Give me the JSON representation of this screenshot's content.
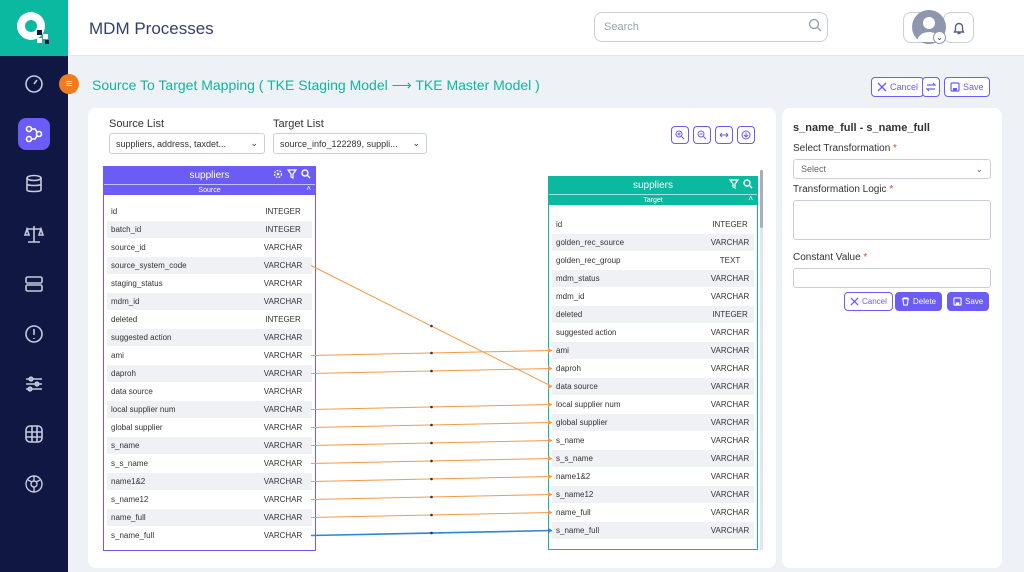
{
  "app": {
    "title": "MDM Processes"
  },
  "search": {
    "placeholder": "Search"
  },
  "page": {
    "heading": "Source To Target Mapping ( TKE Staging Model  ⟶  TKE Master Model )"
  },
  "actions": {
    "cancel": "Cancel",
    "save": "Save"
  },
  "source_list": {
    "label": "Source List",
    "value": "suppliers, address, taxdet..."
  },
  "target_list": {
    "label": "Target List",
    "value": "source_info_122289, suppli..."
  },
  "source_table": {
    "title": "suppliers",
    "subtitle": "Source",
    "rows": [
      [
        "id",
        "INTEGER"
      ],
      [
        "batch_id",
        "INTEGER"
      ],
      [
        "source_id",
        "VARCHAR"
      ],
      [
        "source_system_code",
        "VARCHAR"
      ],
      [
        "staging_status",
        "VARCHAR"
      ],
      [
        "mdm_id",
        "VARCHAR"
      ],
      [
        "deleted",
        "INTEGER"
      ],
      [
        "suggested action",
        "VARCHAR"
      ],
      [
        "ami",
        "VARCHAR"
      ],
      [
        "daproh",
        "VARCHAR"
      ],
      [
        "data source",
        "VARCHAR"
      ],
      [
        "local supplier num",
        "VARCHAR"
      ],
      [
        "global supplier",
        "VARCHAR"
      ],
      [
        "s_name",
        "VARCHAR"
      ],
      [
        "s_s_name",
        "VARCHAR"
      ],
      [
        "name1&2",
        "VARCHAR"
      ],
      [
        "s_name12",
        "VARCHAR"
      ],
      [
        "name_full",
        "VARCHAR"
      ],
      [
        "s_name_full",
        "VARCHAR"
      ]
    ]
  },
  "target_table": {
    "title": "suppliers",
    "subtitle": "Target",
    "rows": [
      [
        "id",
        "INTEGER"
      ],
      [
        "golden_rec_source",
        "VARCHAR"
      ],
      [
        "golden_rec_group",
        "TEXT"
      ],
      [
        "mdm_status",
        "VARCHAR"
      ],
      [
        "mdm_id",
        "VARCHAR"
      ],
      [
        "deleted",
        "INTEGER"
      ],
      [
        "suggested action",
        "VARCHAR"
      ],
      [
        "ami",
        "VARCHAR"
      ],
      [
        "daproh",
        "VARCHAR"
      ],
      [
        "data source",
        "VARCHAR"
      ],
      [
        "local supplier num",
        "VARCHAR"
      ],
      [
        "global supplier",
        "VARCHAR"
      ],
      [
        "s_name",
        "VARCHAR"
      ],
      [
        "s_s_name",
        "VARCHAR"
      ],
      [
        "name1&2",
        "VARCHAR"
      ],
      [
        "s_name12",
        "VARCHAR"
      ],
      [
        "name_full",
        "VARCHAR"
      ],
      [
        "s_name_full",
        "VARCHAR"
      ]
    ]
  },
  "mappings": [
    {
      "source": "source_system_code",
      "target": "data source",
      "color": "#f39a4a"
    },
    {
      "source": "ami",
      "target": "ami",
      "color": "#f39a4a"
    },
    {
      "source": "daproh",
      "target": "daproh",
      "color": "#f39a4a"
    },
    {
      "source": "local supplier num",
      "target": "local supplier num",
      "color": "#f39a4a"
    },
    {
      "source": "global supplier",
      "target": "global supplier",
      "color": "#f39a4a"
    },
    {
      "source": "s_name",
      "target": "s_name",
      "color": "#f39a4a"
    },
    {
      "source": "s_s_name",
      "target": "s_s_name",
      "color": "#f39a4a"
    },
    {
      "source": "name1&2",
      "target": "name1&2",
      "color": "#f39a4a"
    },
    {
      "source": "s_name12",
      "target": "s_name12",
      "color": "#f39a4a"
    },
    {
      "source": "name_full",
      "target": "name_full",
      "color": "#f39a4a"
    },
    {
      "source": "s_name_full",
      "target": "s_name_full",
      "color": "#2f86d6"
    }
  ],
  "panel": {
    "title": "s_name_full - s_name_full",
    "transformation_label": "Select Transformation",
    "transformation_value": "Select",
    "logic_label": "Transformation Logic",
    "constant_label": "Constant Value",
    "required_mark": "*",
    "cancel": "Cancel",
    "delete": "Delete",
    "save": "Save"
  },
  "colors": {
    "brand": "#0bb8a0",
    "accent": "#6b5cf6",
    "rail": "#0f1742",
    "link": "#f39a4a",
    "selected_link": "#2f86d6"
  }
}
